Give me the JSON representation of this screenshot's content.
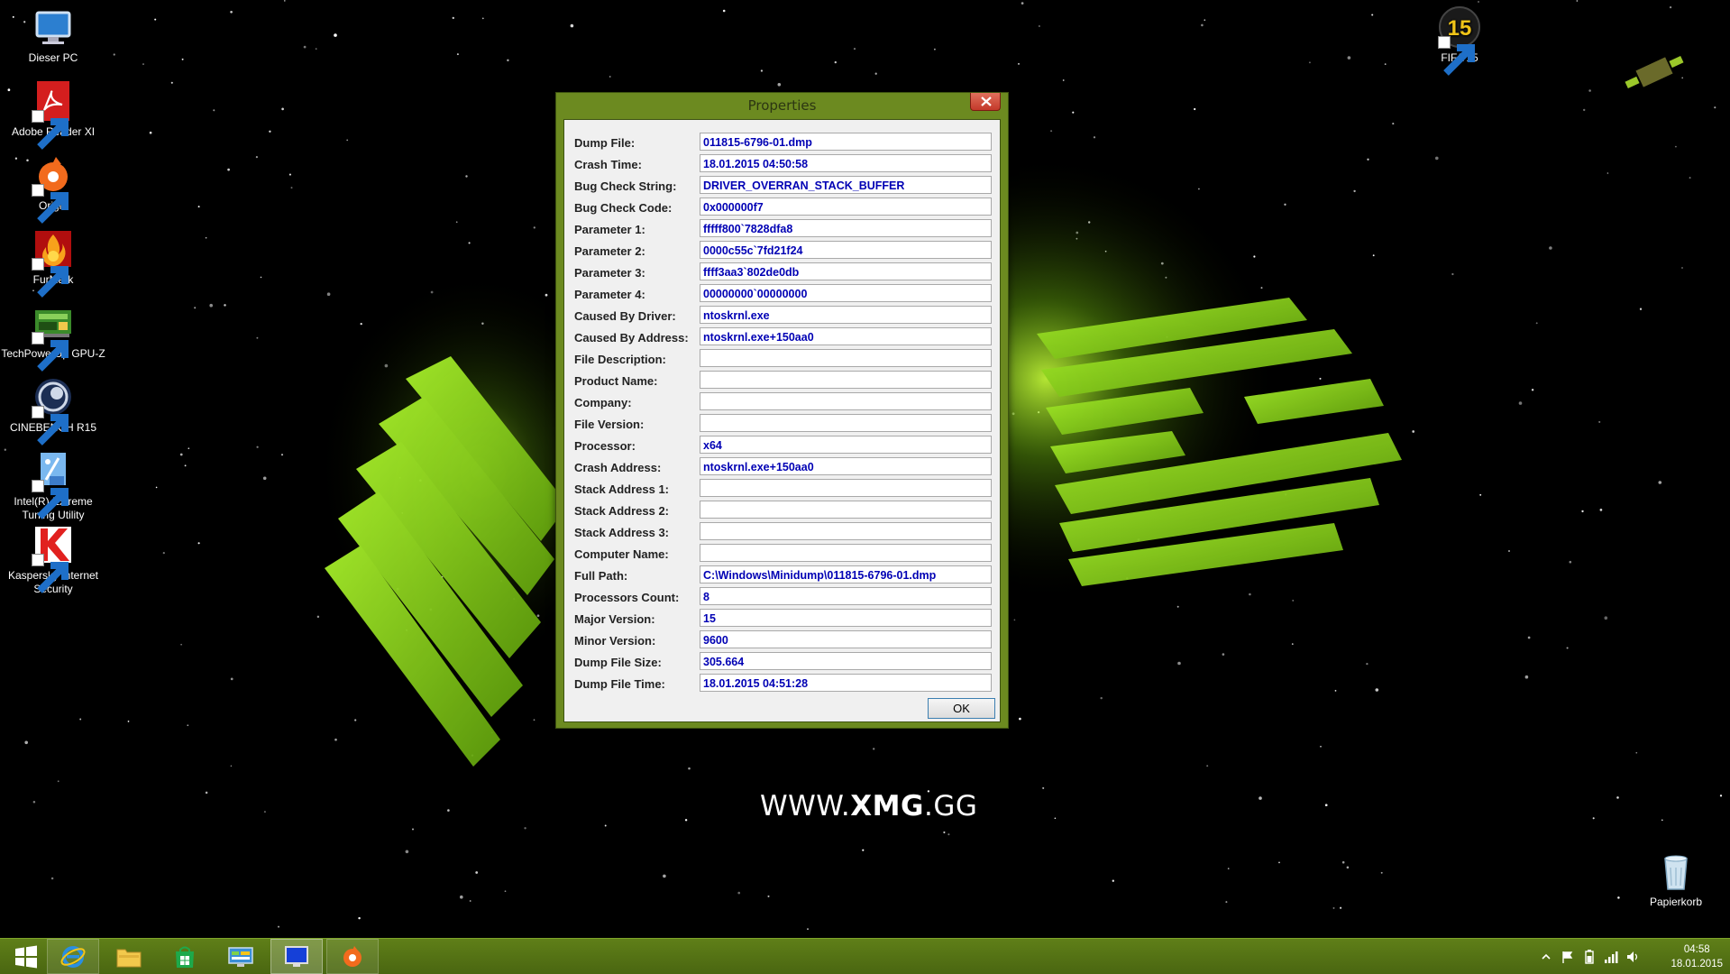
{
  "desktop": {
    "icons_left": [
      {
        "label": "Dieser PC",
        "icon": "computer-icon"
      },
      {
        "label": "Adobe Reader XI",
        "icon": "acrobat-icon"
      },
      {
        "label": "Origin",
        "icon": "origin-icon"
      },
      {
        "label": "FurMark",
        "icon": "furmark-icon"
      },
      {
        "label": "TechPowerUp GPU-Z",
        "icon": "gpuz-icon"
      },
      {
        "label": "CINEBENCH R15",
        "icon": "cinebench-icon"
      },
      {
        "label": "Intel(R) Extreme Tuning Utility",
        "icon": "intel-xtu-icon"
      },
      {
        "label": "Kaspersky Internet Security",
        "icon": "kaspersky-icon"
      }
    ],
    "icon_fifa": {
      "label": "FIFA 15",
      "icon": "fifa-icon",
      "badge": "15"
    },
    "icon_recycle": {
      "label": "Papierkorb",
      "icon": "recycle-bin-icon"
    }
  },
  "wallpaper": {
    "brand_prefix": "WWW.",
    "brand_bold": "XMG",
    "brand_suffix": ".GG",
    "colors": {
      "green": "#9be01a",
      "space": "#000000"
    }
  },
  "properties_window": {
    "title": "Properties",
    "ok_label": "OK",
    "fields": [
      {
        "label": "Dump File:",
        "value": "011815-6796-01.dmp"
      },
      {
        "label": "Crash Time:",
        "value": "18.01.2015 04:50:58"
      },
      {
        "label": "Bug Check String:",
        "value": "DRIVER_OVERRAN_STACK_BUFFER"
      },
      {
        "label": "Bug Check Code:",
        "value": "0x000000f7"
      },
      {
        "label": "Parameter 1:",
        "value": "fffff800`7828dfa8"
      },
      {
        "label": "Parameter 2:",
        "value": "0000c55c`7fd21f24"
      },
      {
        "label": "Parameter 3:",
        "value": "ffff3aa3`802de0db"
      },
      {
        "label": "Parameter 4:",
        "value": "00000000`00000000"
      },
      {
        "label": "Caused By Driver:",
        "value": "ntoskrnl.exe"
      },
      {
        "label": "Caused By Address:",
        "value": "ntoskrnl.exe+150aa0"
      },
      {
        "label": "File Description:",
        "value": ""
      },
      {
        "label": "Product Name:",
        "value": ""
      },
      {
        "label": "Company:",
        "value": ""
      },
      {
        "label": "File Version:",
        "value": ""
      },
      {
        "label": "Processor:",
        "value": "x64"
      },
      {
        "label": "Crash Address:",
        "value": "ntoskrnl.exe+150aa0"
      },
      {
        "label": "Stack Address 1:",
        "value": ""
      },
      {
        "label": "Stack Address 2:",
        "value": ""
      },
      {
        "label": "Stack Address 3:",
        "value": ""
      },
      {
        "label": "Computer Name:",
        "value": ""
      },
      {
        "label": "Full Path:",
        "value": "C:\\Windows\\Minidump\\011815-6796-01.dmp"
      },
      {
        "label": "Processors Count:",
        "value": "8"
      },
      {
        "label": "Major Version:",
        "value": "15"
      },
      {
        "label": "Minor Version:",
        "value": "9600"
      },
      {
        "label": "Dump File Size:",
        "value": "305.664"
      },
      {
        "label": "Dump File Time:",
        "value": "18.01.2015 04:51:28"
      }
    ]
  },
  "taskbar": {
    "buttons": [
      {
        "name": "start-button",
        "icon": "windows-logo-icon"
      },
      {
        "name": "internet-explorer-button",
        "icon": "internet-explorer-icon"
      },
      {
        "name": "file-explorer-button",
        "icon": "folder-icon"
      },
      {
        "name": "store-button",
        "icon": "store-icon"
      },
      {
        "name": "control-panel-button",
        "icon": "control-panel-icon"
      },
      {
        "name": "bluescreenview-button",
        "icon": "bluescreen-icon",
        "state": "active"
      },
      {
        "name": "origin-taskbar-button",
        "icon": "origin-icon",
        "state": "running"
      }
    ],
    "tray_icons": [
      "chevron-up-icon",
      "action-center-flag-icon",
      "power-icon",
      "network-icon",
      "volume-icon"
    ],
    "clock_time": "04:58",
    "clock_date": "18.01.2015"
  }
}
